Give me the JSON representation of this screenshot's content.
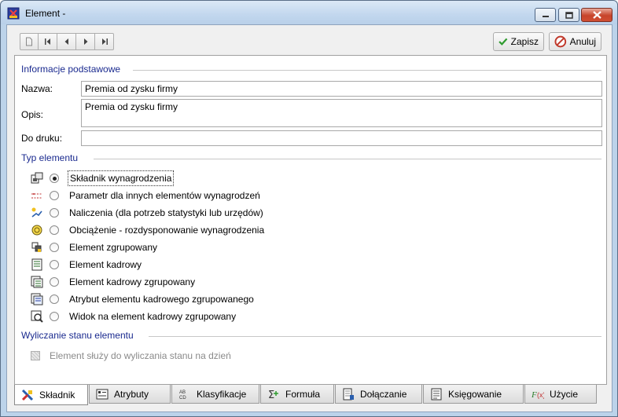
{
  "window": {
    "title": "Element -"
  },
  "toolbar": {
    "nav_buttons": [
      {
        "name": "new-record-button",
        "icon": "page-icon"
      },
      {
        "name": "first-record-button",
        "icon": "first-icon"
      },
      {
        "name": "prev-record-button",
        "icon": "prev-icon"
      },
      {
        "name": "next-record-button",
        "icon": "next-icon"
      },
      {
        "name": "last-record-button",
        "icon": "last-icon"
      }
    ],
    "save_label": "Zapisz",
    "cancel_label": "Anuluj"
  },
  "basic": {
    "section_title": "Informacje podstawowe",
    "name_label": "Nazwa:",
    "name_value": "Premia od zysku firmy",
    "desc_label": "Opis:",
    "desc_value": "Premia od zysku firmy",
    "print_label": "Do druku:",
    "print_value": ""
  },
  "type": {
    "section_title": "Typ elementu",
    "options": [
      {
        "label": "Składnik wynagrodzenia",
        "icon": "salary-component-icon",
        "selected": true
      },
      {
        "label": "Parametr dla innych elementów wynagrodzeń",
        "icon": "parameter-icon",
        "selected": false
      },
      {
        "label": "Naliczenia (dla potrzeb statystyki lub urzędów)",
        "icon": "calculation-icon",
        "selected": false
      },
      {
        "label": "Obciążenie - rozdysponowanie wynagrodzenia",
        "icon": "charge-icon",
        "selected": false
      },
      {
        "label": "Element zgrupowany",
        "icon": "grouped-element-icon",
        "selected": false
      },
      {
        "label": "Element kadrowy",
        "icon": "hr-element-icon",
        "selected": false
      },
      {
        "label": "Element kadrowy zgrupowany",
        "icon": "hr-grouped-icon",
        "selected": false
      },
      {
        "label": "Atrybut elementu kadrowego zgrupowanego",
        "icon": "hr-attribute-icon",
        "selected": false
      },
      {
        "label": "Widok na element kadrowy zgrupowany",
        "icon": "hr-view-icon",
        "selected": false
      }
    ]
  },
  "state": {
    "section_title": "Wyliczanie stanu elementu",
    "checkbox_label": "Element służy do wyliczania stanu na dzień"
  },
  "tabs": [
    {
      "label": "Składnik",
      "icon": "component-tab-icon",
      "active": true
    },
    {
      "label": "Atrybuty",
      "icon": "attributes-tab-icon",
      "active": false
    },
    {
      "label": "Klasyfikacje",
      "icon": "classification-tab-icon",
      "active": false
    },
    {
      "label": "Formuła",
      "icon": "formula-tab-icon",
      "active": false
    },
    {
      "label": "Dołączanie",
      "icon": "attach-tab-icon",
      "active": false
    },
    {
      "label": "Księgowanie",
      "icon": "accounting-tab-icon",
      "active": false
    },
    {
      "label": "Użycie",
      "icon": "usage-tab-icon",
      "active": false
    }
  ],
  "colors": {
    "section_title": "#1a2a8f",
    "accent_green": "#2e9b2e",
    "cancel_red": "#c0392b"
  }
}
